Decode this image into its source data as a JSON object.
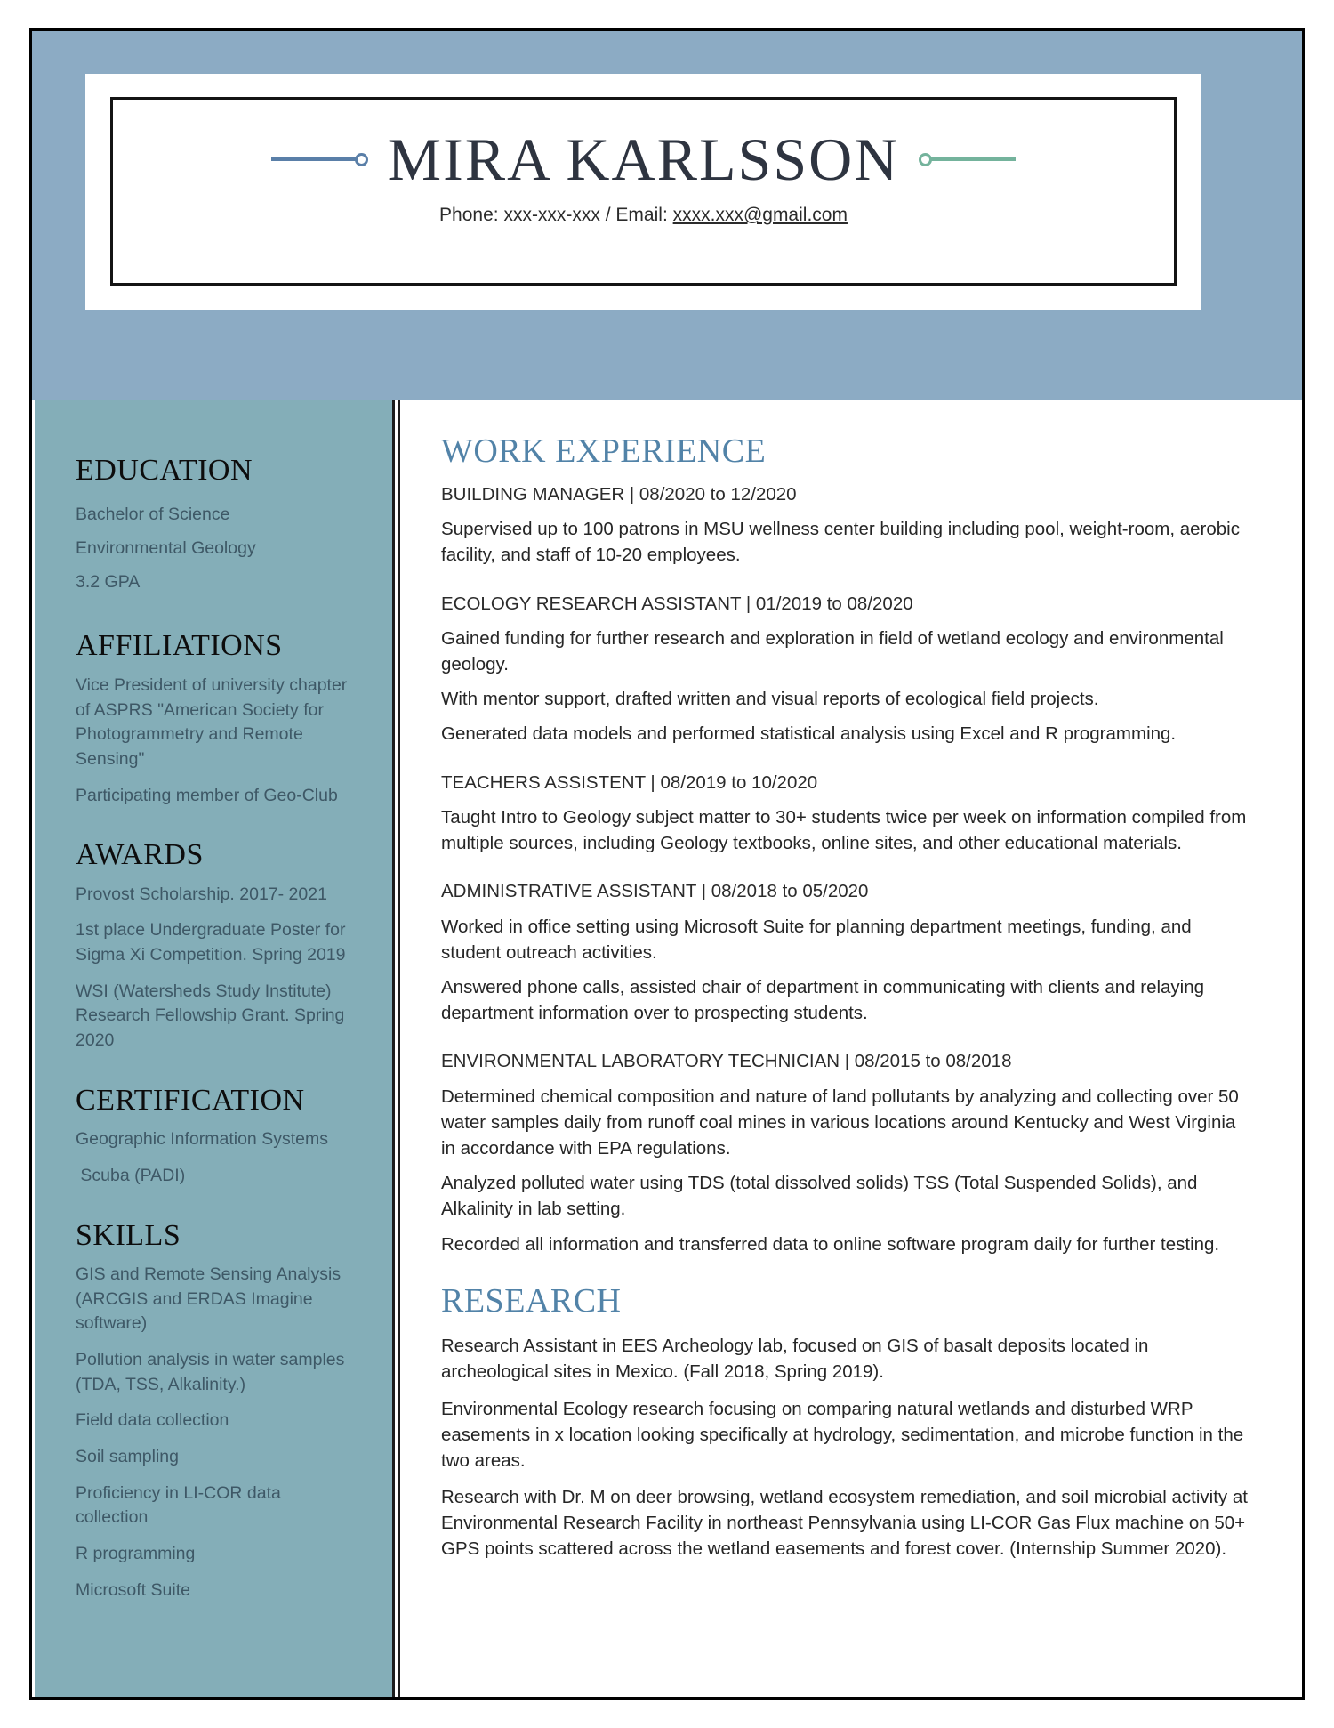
{
  "colors": {
    "header_band": "#8CABC4",
    "sidebar": "#84AEB8",
    "main_heading": "#5283A8",
    "deco_left": "#5A7FA8",
    "deco_right": "#74B39C",
    "sidebar_text": "#3E5866",
    "frame_border": "#000000"
  },
  "header": {
    "name": "MIRA KARLSSON",
    "contact_prefix": "Phone: xxx-xxx-xxx / Email: ",
    "email": "xxxx.xxx@gmail.com"
  },
  "sidebar": {
    "sections": [
      {
        "heading": "EDUCATION",
        "items": [
          "Bachelor of Science",
          "Environmental Geology",
          "3.2 GPA"
        ]
      },
      {
        "heading": "AFFILIATIONS",
        "items": [
          "Vice President of university chapter of ASPRS \"American Society for Photogrammetry and Remote Sensing\"",
          "Participating member of Geo-Club"
        ]
      },
      {
        "heading": "AWARDS",
        "items": [
          "Provost Scholarship. 2017- 2021",
          "1st place Undergraduate Poster for Sigma Xi Competition. Spring 2019",
          "WSI (Watersheds Study Institute) Research Fellowship Grant. Spring 2020"
        ]
      },
      {
        "heading": "CERTIFICATION",
        "items": [
          "Geographic Information Systems",
          " Scuba (PADI)"
        ]
      },
      {
        "heading": "SKILLS",
        "items": [
          "GIS and Remote Sensing Analysis (ARCGIS and ERDAS Imagine software)",
          "Pollution analysis in water samples (TDA, TSS, Alkalinity.)",
          "Field data collection",
          "Soil sampling",
          "Proficiency in LI-COR data collection",
          "R programming",
          "Microsoft Suite"
        ]
      }
    ]
  },
  "main": {
    "work_heading": "WORK EXPERIENCE",
    "jobs": [
      {
        "title": "BUILDING MANAGER | 08/2020 to 12/2020",
        "bullets": [
          "Supervised up to 100 patrons in MSU wellness center building including pool, weight-room, aerobic facility, and staff of 10-20 employees."
        ]
      },
      {
        "title": "ECOLOGY RESEARCH ASSISTANT | 01/2019 to 08/2020",
        "bullets": [
          "Gained funding for further research and exploration in field of wetland ecology and environmental geology.",
          "With mentor support, drafted written and visual reports of ecological field projects.",
          "Generated data models and performed statistical analysis using Excel and R programming."
        ]
      },
      {
        "title": "TEACHERS ASSISTENT | 08/2019 to 10/2020",
        "bullets": [
          "Taught Intro to Geology subject matter to 30+ students twice per week on information compiled from multiple sources, including Geology textbooks, online sites, and other educational materials."
        ]
      },
      {
        "title": "ADMINISTRATIVE ASSISTANT | 08/2018 to 05/2020",
        "bullets": [
          "Worked in office setting using Microsoft Suite for planning department meetings, funding, and student outreach activities.",
          "Answered phone calls, assisted chair of department in communicating with clients and relaying department information over to prospecting students."
        ]
      },
      {
        "title": "ENVIRONMENTAL LABORATORY TECHNICIAN | 08/2015 to 08/2018",
        "bullets": [
          "Determined chemical composition and nature of land pollutants by analyzing and collecting over 50 water samples daily from runoff coal mines in various locations around Kentucky and West Virginia in accordance with EPA regulations.",
          "Analyzed polluted water using TDS (total dissolved solids) TSS (Total Suspended Solids), and Alkalinity in lab setting.",
          "Recorded all information and transferred data to online software program daily for further testing."
        ]
      }
    ],
    "research_heading": "RESEARCH",
    "research_items": [
      "Research Assistant in EES Archeology lab, focused on GIS of basalt deposits located in archeological sites in Mexico. (Fall 2018, Spring 2019).",
      "Environmental Ecology research focusing on comparing natural wetlands and disturbed WRP easements in x location looking specifically at hydrology, sedimentation, and microbe function in the two areas.",
      "Research with Dr. M on deer browsing, wetland ecosystem remediation, and soil microbial activity at Environmental Research Facility in northeast Pennsylvania using LI-COR Gas Flux machine on 50+ GPS points scattered across the wetland easements and forest cover. (Internship Summer 2020)."
    ]
  }
}
